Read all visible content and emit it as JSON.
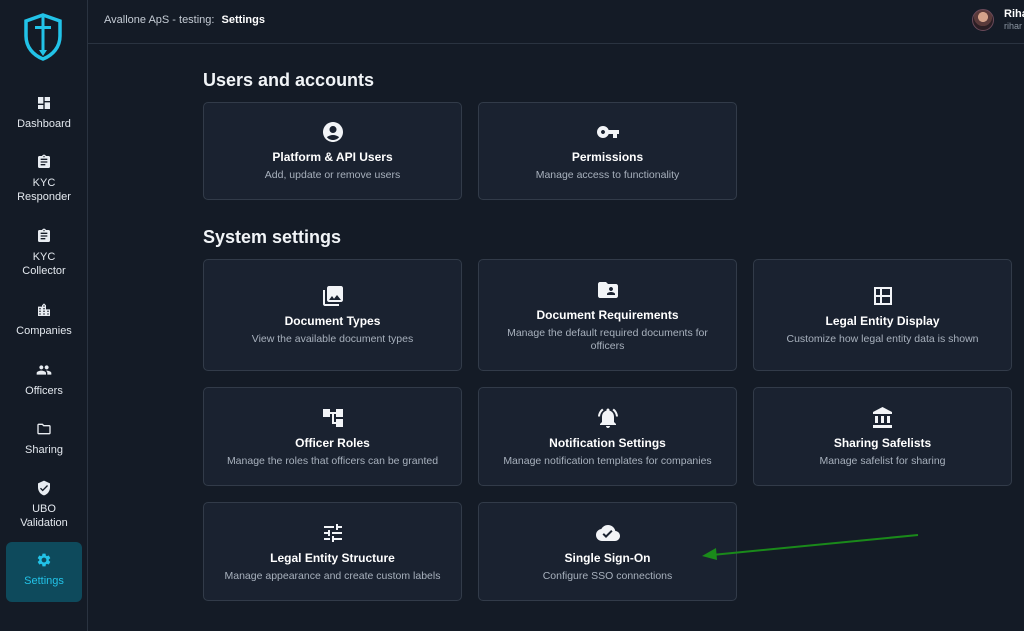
{
  "sidebar": {
    "items": [
      {
        "label": "Dashboard",
        "icon": "dashboard-icon"
      },
      {
        "label": "KYC\nResponder",
        "icon": "clipboard-icon"
      },
      {
        "label": "KYC\nCollector",
        "icon": "clipboard-icon"
      },
      {
        "label": "Companies",
        "icon": "building-icon"
      },
      {
        "label": "Officers",
        "icon": "people-icon"
      },
      {
        "label": "Sharing",
        "icon": "folder-icon"
      },
      {
        "label": "UBO\nValidation",
        "icon": "shield-check-icon"
      },
      {
        "label": "Settings",
        "icon": "gear-icon"
      }
    ],
    "active_color": "#22c3e8"
  },
  "header": {
    "breadcrumb_org": "Avallone ApS - testing:",
    "breadcrumb_page": "Settings",
    "user_name": "Riha",
    "user_sub": "rihar"
  },
  "sections": {
    "users_title": "Users and accounts",
    "system_title": "System settings"
  },
  "cards": {
    "platform_users": {
      "title": "Platform & API Users",
      "desc": "Add, update or remove users",
      "icon": "account-circle-icon"
    },
    "permissions": {
      "title": "Permissions",
      "desc": "Manage access to functionality",
      "icon": "key-icon"
    },
    "document_types": {
      "title": "Document Types",
      "desc": "View the available document types",
      "icon": "photo-library-icon"
    },
    "document_requirements": {
      "title": "Document Requirements",
      "desc": "Manage the default required documents for officers",
      "icon": "folder-shared-icon"
    },
    "legal_entity_display": {
      "title": "Legal Entity Display",
      "desc": "Customize how legal entity data is shown",
      "icon": "dashboard-layout-icon"
    },
    "officer_roles": {
      "title": "Officer Roles",
      "desc": "Manage the roles that officers can be granted",
      "icon": "hierarchy-icon"
    },
    "notification_settings": {
      "title": "Notification Settings",
      "desc": "Manage notification templates for companies",
      "icon": "bell-ring-icon"
    },
    "sharing_safelists": {
      "title": "Sharing Safelists",
      "desc": "Manage safelist for sharing",
      "icon": "bank-icon"
    },
    "legal_entity_structure": {
      "title": "Legal Entity Structure",
      "desc": "Manage appearance and create custom labels",
      "icon": "tune-icon"
    },
    "sso": {
      "title": "Single Sign-On",
      "desc": "Configure SSO connections",
      "icon": "cloud-done-icon"
    }
  },
  "annotation": {
    "arrow_color": "#1a8a1a"
  }
}
